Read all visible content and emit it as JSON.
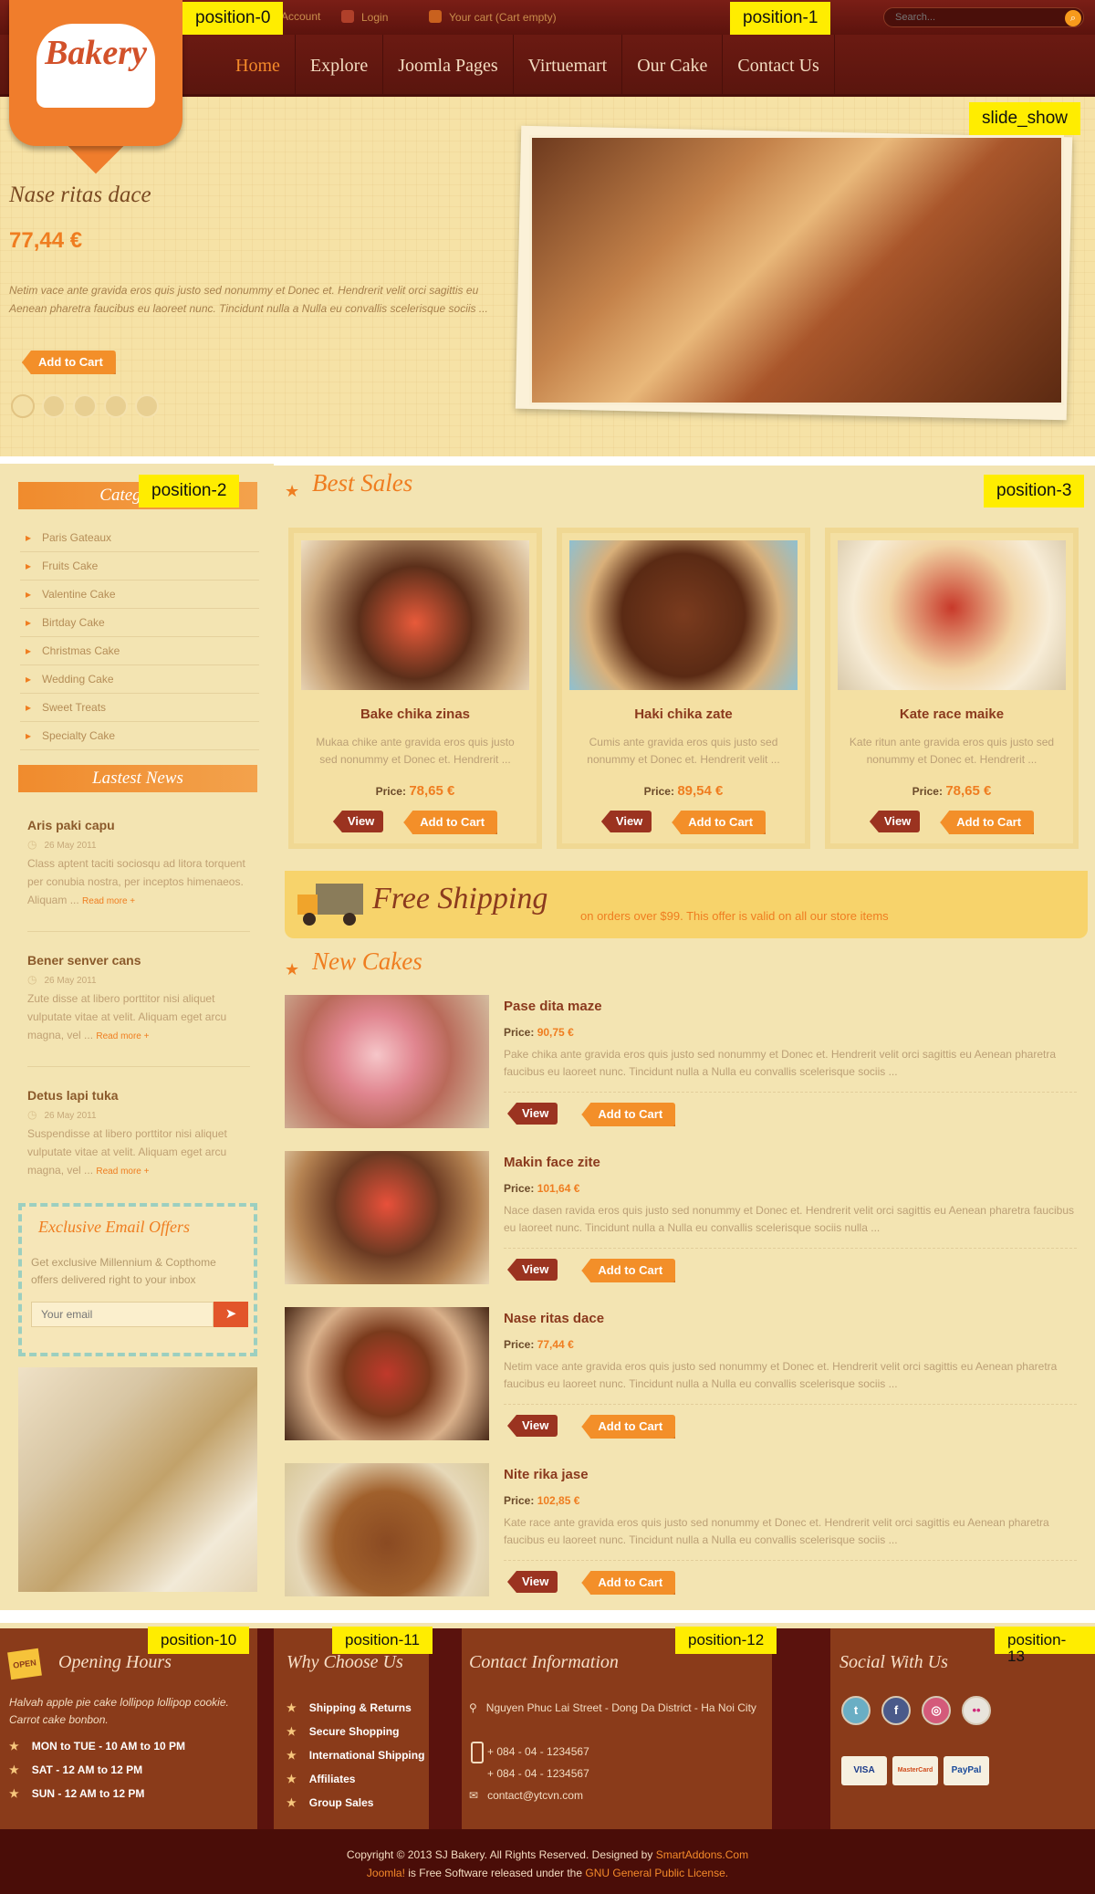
{
  "position_labels": {
    "p0": "position-0",
    "p1": "position-1",
    "slide": "slide_show",
    "p2": "position-2",
    "p3": "position-3",
    "p10": "position-10",
    "p11": "position-11",
    "p12": "position-12",
    "p13": "position-13"
  },
  "topbar": {
    "account": "Account",
    "login": "Login",
    "cart": "Your cart (Cart empty)",
    "search_placeholder": "Search..."
  },
  "logo": {
    "text": "Bakery"
  },
  "nav": [
    "Home",
    "Explore",
    "Joomla Pages",
    "Virtuemart",
    "Our Cake",
    "Contact Us"
  ],
  "slideshow": {
    "title": "Nase ritas dace",
    "price": "77,44 €",
    "desc": "Netim vace ante gravida eros quis justo sed nonummy et Donec et. Hendrerit velit orci sagittis eu Aenean pharetra faucibus eu laoreet nunc. Tincidunt nulla a Nulla eu convallis scelerisque sociis ...",
    "add_to_cart": "Add to Cart",
    "dots": 5,
    "active_dot": 1
  },
  "sidebar": {
    "categories_title": "Categories",
    "categories": [
      "Paris Gateaux",
      "Fruits Cake",
      "Valentine Cake",
      "Birtday Cake",
      "Christmas Cake",
      "Wedding Cake",
      "Sweet Treats",
      "Specialty Cake"
    ],
    "news_title": "Lastest News",
    "news": [
      {
        "title": "Aris paki capu",
        "date": "26 May 2011",
        "text": "Class aptent taciti sociosqu ad litora torquent per conubia nostra, per inceptos himenaeos. Aliquam ...",
        "more": "Read more +"
      },
      {
        "title": "Bener senver cans",
        "date": "26 May 2011",
        "text": "Zute disse at libero porttitor nisi aliquet vulputate vitae at velit. Aliquam eget arcu magna, vel ...",
        "more": "Read more +"
      },
      {
        "title": "Detus lapi tuka",
        "date": "26 May 2011",
        "text": "Suspendisse at libero porttitor nisi aliquet vulputate vitae at velit. Aliquam eget arcu magna, vel ...",
        "more": "Read more +"
      }
    ],
    "email": {
      "title": "Exclusive Email Offers",
      "text": "Get exclusive Millennium & Copthome offers delivered right to your inbox",
      "placeholder": "Your email"
    }
  },
  "best_sales": {
    "title": "Best Sales",
    "products": [
      {
        "name": "Bake chika zinas",
        "desc": "Mukaa chike ante gravida eros quis justo sed nonummy et Donec et. Hendrerit ...",
        "price_label": "Price:",
        "price": "78,65 €"
      },
      {
        "name": "Haki chika zate",
        "desc": "Cumis ante gravida eros quis justo sed nonummy et Donec et. Hendrerit velit ...",
        "price_label": "Price:",
        "price": "89,54 €"
      },
      {
        "name": "Kate race maike",
        "desc": "Kate ritun ante gravida eros quis justo sed nonummy et Donec et. Hendrerit ...",
        "price_label": "Price:",
        "price": "78,65 €"
      }
    ]
  },
  "buttons": {
    "view": "View",
    "add_to_cart": "Add to Cart"
  },
  "shipping": {
    "title": "Free Shipping",
    "text": "on orders over $99. This offer is valid on all our store items"
  },
  "new_cakes": {
    "title": "New Cakes",
    "items": [
      {
        "name": "Pase dita maze",
        "price_label": "Price:",
        "price": "90,75 €",
        "desc": "Pake chika ante gravida eros quis justo sed nonummy et Donec et. Hendrerit velit orci sagittis eu Aenean pharetra faucibus eu laoreet nunc. Tincidunt nulla a Nulla eu convallis scelerisque sociis ..."
      },
      {
        "name": "Makin face zite",
        "price_label": "Price:",
        "price": "101,64 €",
        "desc": "Nace dasen ravida eros quis justo sed nonummy et Donec et. Hendrerit velit orci sagittis eu Aenean pharetra faucibus eu laoreet nunc. Tincidunt nulla a Nulla eu convallis scelerisque sociis nulla ..."
      },
      {
        "name": "Nase ritas dace",
        "price_label": "Price:",
        "price": "77,44 €",
        "desc": "Netim vace ante gravida eros quis justo sed nonummy et Donec et. Hendrerit velit orci sagittis eu Aenean pharetra faucibus eu laoreet nunc. Tincidunt nulla a Nulla eu convallis scelerisque sociis ..."
      },
      {
        "name": "Nite rika jase",
        "price_label": "Price:",
        "price": "102,85 €",
        "desc": "Kate race ante gravida eros quis justo sed nonummy et Donec et. Hendrerit velit orci sagittis eu Aenean pharetra faucibus eu laoreet nunc. Tincidunt nulla a Nulla eu convallis scelerisque sociis ..."
      }
    ]
  },
  "footer": {
    "hours": {
      "title": "Opening Hours",
      "intro": "Halvah apple pie cake lollipop lollipop cookie. Carrot cake bonbon.",
      "lines": [
        "MON to TUE - 10 AM to 10 PM",
        "SAT - 12 AM to 12 PM",
        "SUN - 12 AM to 12 PM"
      ],
      "badge": "OPEN"
    },
    "why": {
      "title": "Why Choose Us",
      "items": [
        "Shipping & Returns",
        "Secure Shopping",
        "International Shipping",
        "Affiliates",
        "Group Sales"
      ]
    },
    "contact": {
      "title": "Contact Information",
      "address": "Nguyen Phuc Lai Street - Dong Da District - Ha Noi City",
      "phone1": "+ 084 - 04 - 1234567",
      "phone2": "+ 084 - 04 - 1234567",
      "email": "contact@ytcvn.com"
    },
    "social": {
      "title": "Social With Us",
      "networks": [
        "twitter-icon",
        "facebook-icon",
        "dribbble-icon",
        "flickr-icon"
      ],
      "payments": [
        "VISA",
        "MasterCard",
        "PayPal"
      ]
    }
  },
  "copyright": {
    "line1_a": "Copyright © 2013 SJ Bakery. All Rights Reserved. Designed by ",
    "line1_b": "SmartAddons.Com",
    "line2_a": "Joomla!",
    "line2_b": " is Free Software released under the ",
    "line2_c": "GNU General Public License."
  }
}
